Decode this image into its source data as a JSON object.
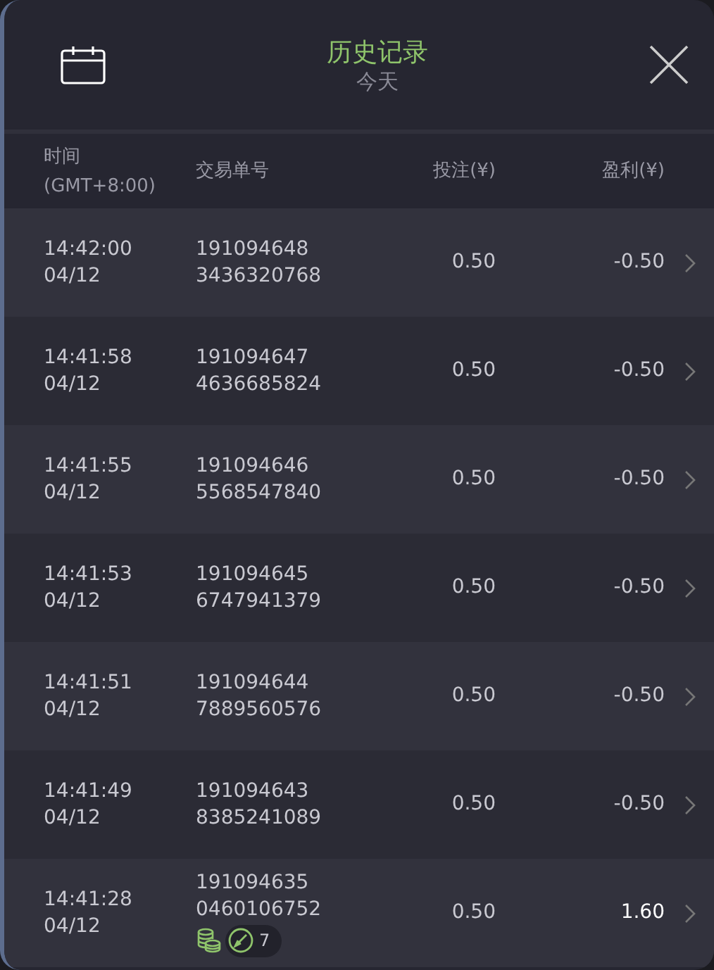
{
  "header": {
    "title": "历史记录",
    "subtitle": "今天"
  },
  "columns": [
    {
      "kind": "time",
      "label": "时间",
      "sublabel": "(GMT+8:00)"
    },
    {
      "kind": "id",
      "label": "交易单号"
    },
    {
      "kind": "stake",
      "label": "投注(¥)"
    },
    {
      "kind": "profit",
      "label": "盈利(¥)"
    }
  ],
  "rows": [
    {
      "time": "14:42:00",
      "date": "04/12",
      "id1": "191094648",
      "id2": "3436320768",
      "stake": "0.50",
      "profit": "-0.50",
      "win": false
    },
    {
      "time": "14:41:58",
      "date": "04/12",
      "id1": "191094647",
      "id2": "4636685824",
      "stake": "0.50",
      "profit": "-0.50",
      "win": false
    },
    {
      "time": "14:41:55",
      "date": "04/12",
      "id1": "191094646",
      "id2": "5568547840",
      "stake": "0.50",
      "profit": "-0.50",
      "win": false
    },
    {
      "time": "14:41:53",
      "date": "04/12",
      "id1": "191094645",
      "id2": "6747941379",
      "stake": "0.50",
      "profit": "-0.50",
      "win": false
    },
    {
      "time": "14:41:51",
      "date": "04/12",
      "id1": "191094644",
      "id2": "7889560576",
      "stake": "0.50",
      "profit": "-0.50",
      "win": false
    },
    {
      "time": "14:41:49",
      "date": "04/12",
      "id1": "191094643",
      "id2": "8385241089",
      "stake": "0.50",
      "profit": "-0.50",
      "win": false
    },
    {
      "time": "14:41:28",
      "date": "04/12",
      "id1": "191094635",
      "id2": "0460106752",
      "stake": "0.50",
      "profit": "1.60",
      "win": true,
      "bonus": {
        "count": "7"
      }
    }
  ]
}
